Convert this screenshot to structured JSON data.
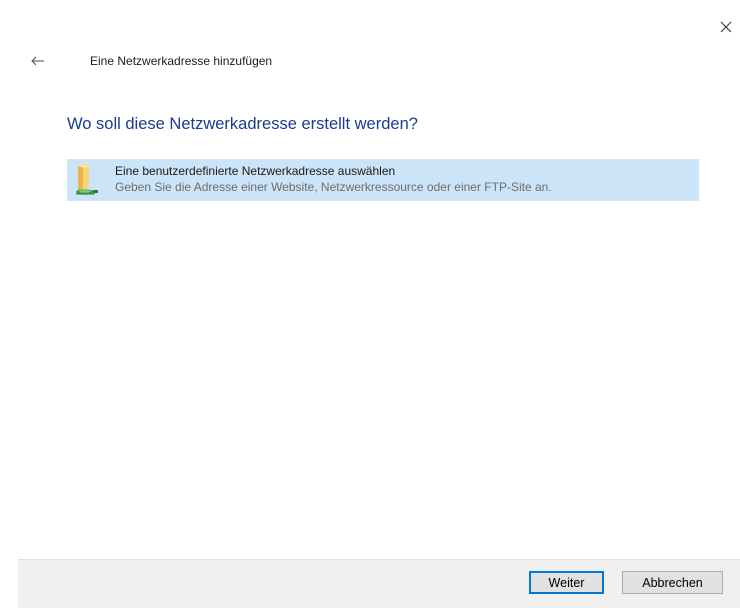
{
  "window": {
    "close_icon": "close-icon",
    "back_icon": "back-arrow-icon"
  },
  "header": {
    "title": "Eine Netzwerkadresse hinzufügen"
  },
  "main": {
    "heading": "Wo soll diese Netzwerkadresse erstellt werden?",
    "options": [
      {
        "icon": "folder-network-icon",
        "title": "Eine benutzerdefinierte Netzwerkadresse auswählen",
        "description": "Geben Sie die Adresse einer Website, Netzwerkressource oder einer FTP-Site an.",
        "selected": true
      }
    ]
  },
  "footer": {
    "next_label": "Weiter",
    "cancel_label": "Abbrechen"
  },
  "colors": {
    "heading": "#1a3c8f",
    "selection": "#cce4f7",
    "footer_bg": "#f0f0f0",
    "focus_border": "#0078d7"
  }
}
